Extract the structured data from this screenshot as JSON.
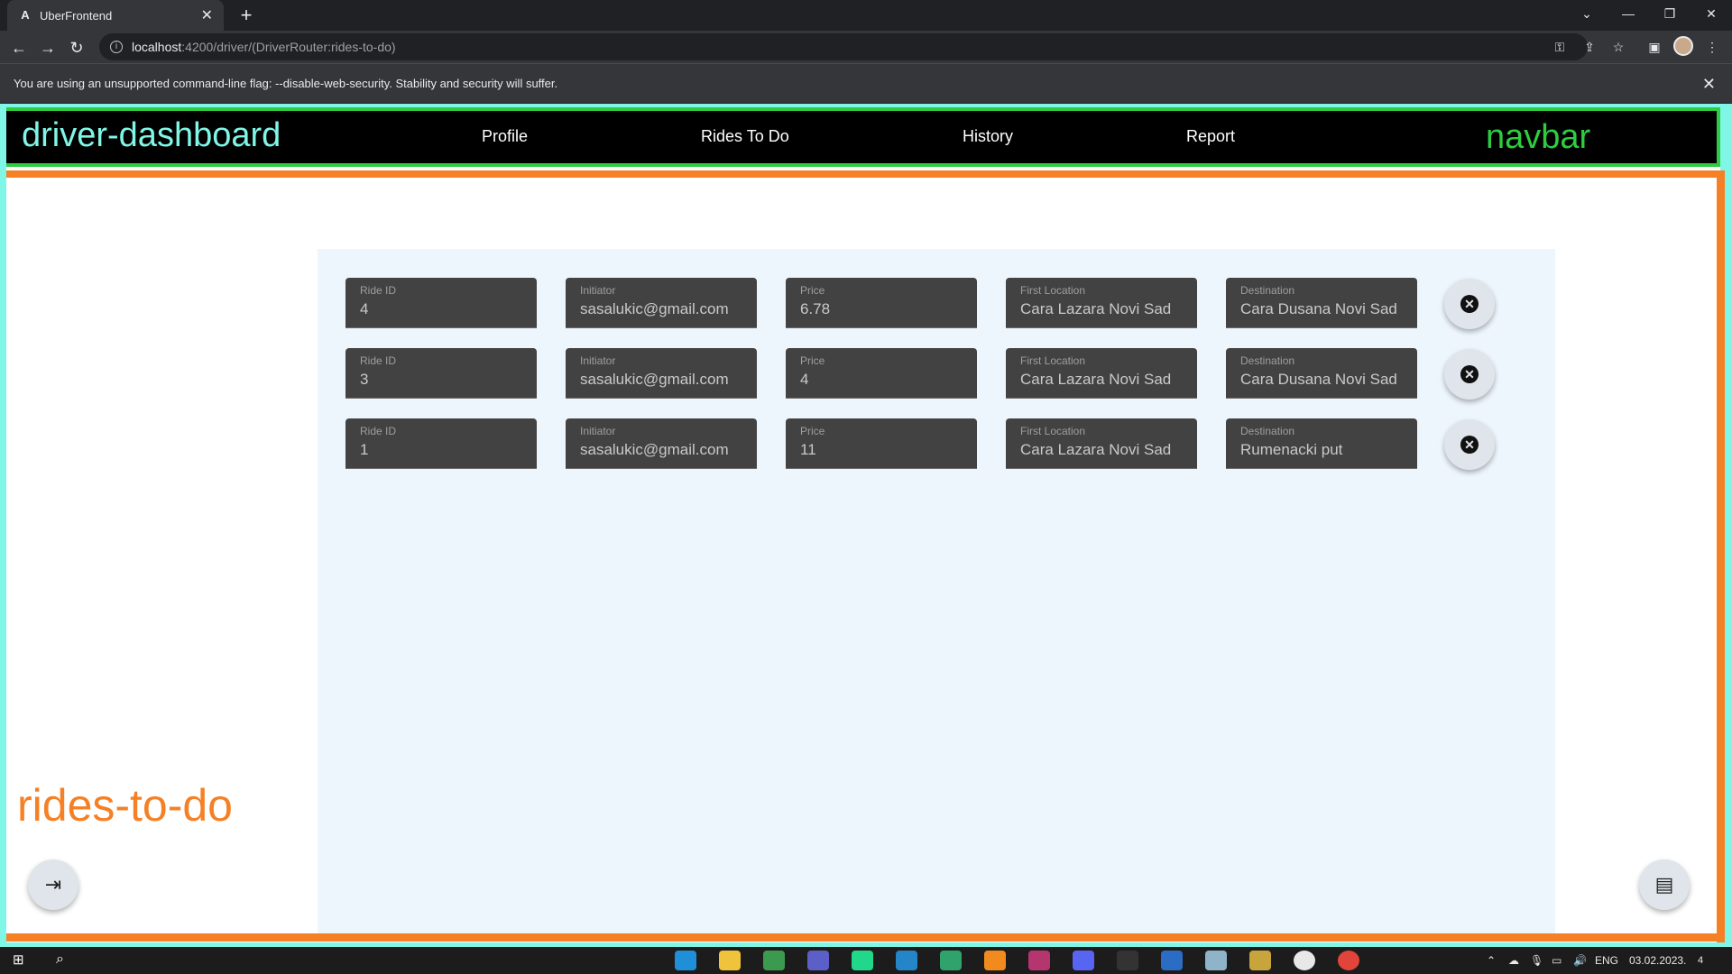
{
  "browser": {
    "tab_title": "UberFrontend",
    "tab_favicon": "A",
    "new_tab": "+",
    "url_host": "localhost",
    "url_path": ":4200/driver/(DriverRouter:rides-to-do)",
    "infobar_message": "You are using an unsupported command-line flag: --disable-web-security. Stability and security will suffer."
  },
  "app": {
    "brand": "driver-dashboard",
    "navbar_tag": "navbar",
    "component_tag": "rides-to-do",
    "nav": [
      {
        "label": "Profile"
      },
      {
        "label": "Rides To Do"
      },
      {
        "label": "History"
      },
      {
        "label": "Report"
      }
    ],
    "field_labels": {
      "ride_id": "Ride ID",
      "initiator": "Initiator",
      "price": "Price",
      "first_location": "First Location",
      "destination": "Destination"
    },
    "rides": [
      {
        "ride_id": "4",
        "initiator": "sasalukic@gmail.com",
        "price": "6.78",
        "first_location": "Cara Lazara Novi Sad",
        "destination": "Cara Dusana Novi Sad"
      },
      {
        "ride_id": "3",
        "initiator": "sasalukic@gmail.com",
        "price": "4",
        "first_location": "Cara Lazara Novi Sad",
        "destination": "Cara Dusana Novi Sad"
      },
      {
        "ride_id": "1",
        "initiator": "sasalukic@gmail.com",
        "price": "11",
        "first_location": "Cara Lazara Novi Sad",
        "destination": "Rumenacki put"
      }
    ]
  },
  "taskbar": {
    "language": "ENG",
    "date": "03.02.2023.",
    "notifications": "4"
  },
  "colors": {
    "viewport_border": "#7ff6e6",
    "navbar_border": "#2ecc40",
    "component_border": "#f58025",
    "field_bg": "#424242",
    "panel_bg": "#eef6fd"
  }
}
